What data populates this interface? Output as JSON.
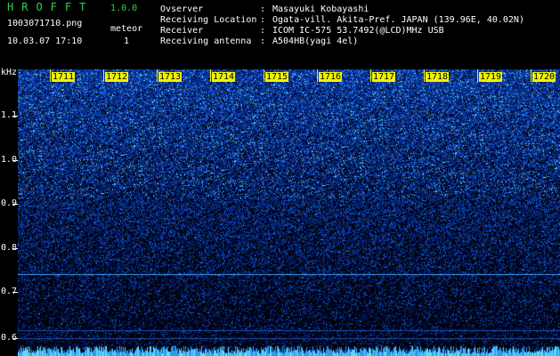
{
  "app": {
    "title": "HROFFT",
    "version": "1.0.0"
  },
  "file": {
    "name": "1003071710.png",
    "datetime": "10.03.07 17:10"
  },
  "meteor": {
    "label": "meteor",
    "count": "1"
  },
  "info": [
    {
      "key": "Ovserver",
      "value": "Masayuki Kobayashi"
    },
    {
      "key": "Receiving Location",
      "value": "Ogata-vill. Akita-Pref. JAPAN (139.96E, 40.02N)"
    },
    {
      "key": "Receiver",
      "value": "ICOM IC-575 53.7492(@LCD)MHz USB"
    },
    {
      "key": "Receiving antenna",
      "value": "A504HB(yagi 4el)"
    }
  ],
  "separator": ":",
  "axis": {
    "unit": "kHz",
    "freq_ticks": [
      "1.1",
      "1.0",
      "0.9",
      "0.8",
      "0.7",
      "0.6"
    ],
    "time_ticks": [
      "1711",
      "1712",
      "1713",
      "1714",
      "1715",
      "1716",
      "1717",
      "1718",
      "1719",
      "1720"
    ]
  },
  "colors": {
    "background": "#000000",
    "header_green": "#2bd54a",
    "time_label_yellow": "#f2f200",
    "spectrum_low": "#0a1a8a",
    "spectrum_high": "#7fe6ff"
  }
}
